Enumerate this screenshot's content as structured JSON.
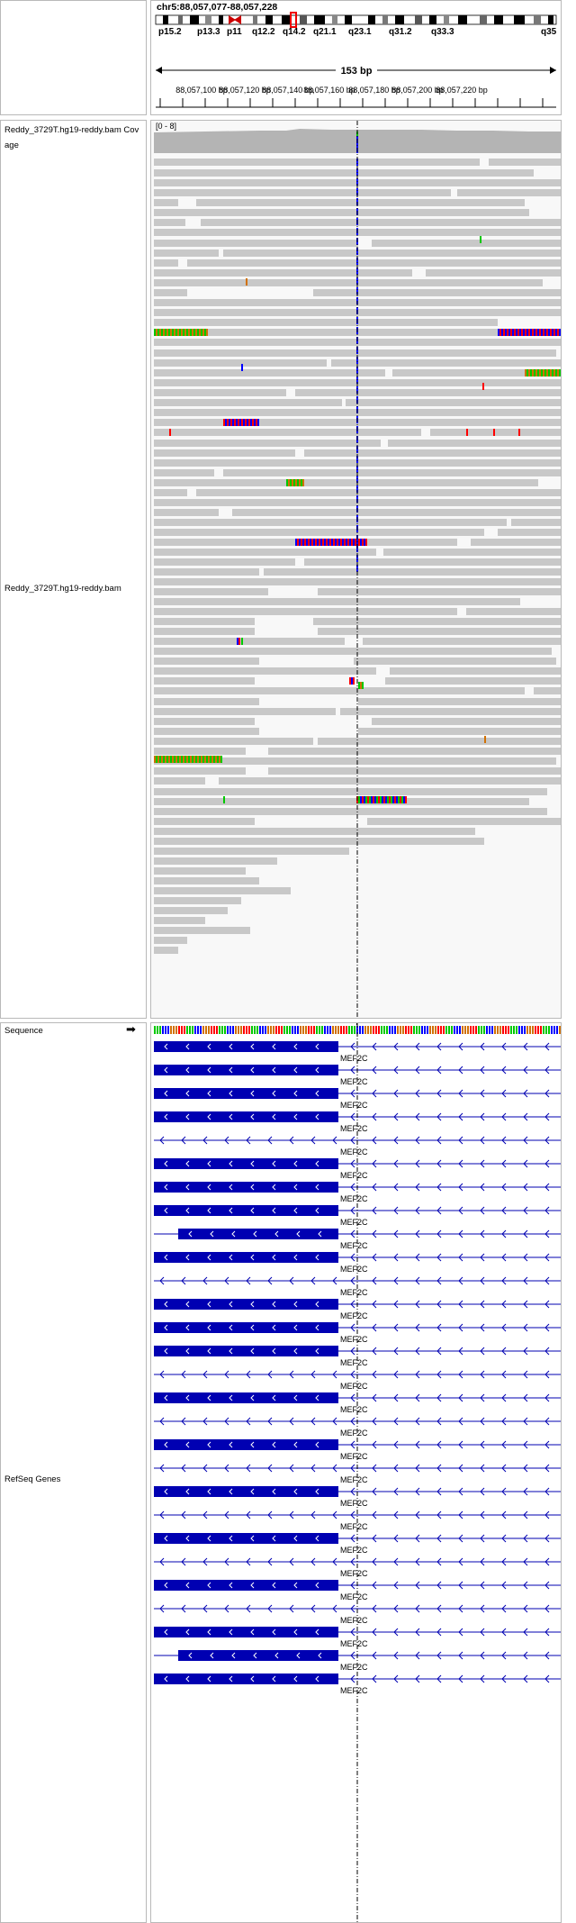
{
  "locus": "chr5:88,057,077-88,057,228",
  "window_size": "153 bp",
  "cytobands": [
    "p15.2",
    "p13.3",
    "p11",
    "q12.2",
    "q14.2",
    "q21.1",
    "q23.1",
    "q31.2",
    "q33.3",
    "q35"
  ],
  "ruler_ticks": [
    "88,057,100 bp",
    "88,057,120 bp",
    "88,057,140 bp",
    "88,057,160 bp",
    "88,057,180 bp",
    "88,057,200 bp",
    "88,057,220 bp"
  ],
  "coverage": {
    "track_name": "Reddy_3729T.hg19-reddy.bam Coverage",
    "track_name_line1": "Reddy_3729T.hg19-reddy.bam Cov",
    "track_name_line2": "age",
    "range_label": "[0 - 8]"
  },
  "alignment": {
    "track_name": "Reddy_3729T.hg19-reddy.bam"
  },
  "sequence": {
    "track_name": "Sequence",
    "strand_arrow": "➡"
  },
  "refseq": {
    "track_name": "RefSeq Genes",
    "gene": "MEF2C",
    "transcript_count": 28
  },
  "colors": {
    "read": "#c8c8c8",
    "coverage": "#b4b4b4",
    "gene": "#0000b2",
    "center_line": "#000000",
    "A": "#00c800",
    "C": "#0000ff",
    "G": "#d17105",
    "T": "#ff0000"
  }
}
